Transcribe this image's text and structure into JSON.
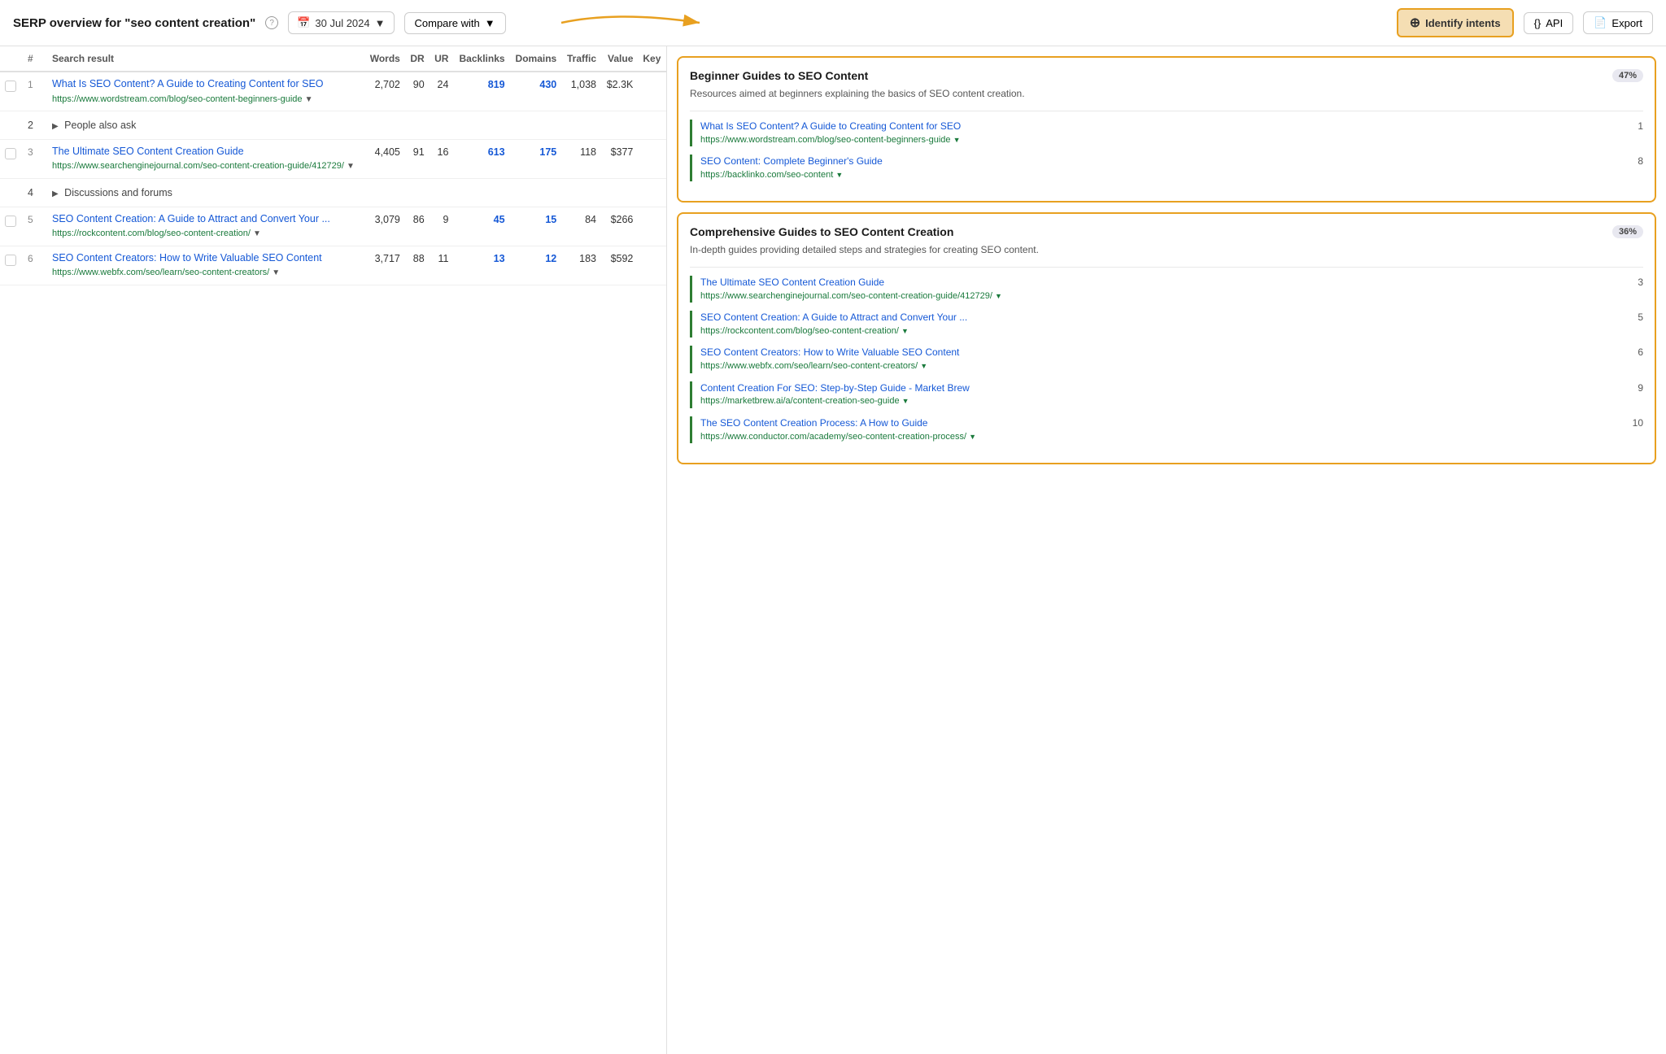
{
  "header": {
    "title": "SERP overview for \"seo content creation\"",
    "help_label": "?",
    "date": "30 Jul 2024",
    "date_icon": "📅",
    "compare_label": "Compare with",
    "compare_arrow": "▼",
    "identify_label": "Identify intents",
    "identify_icon": "⊕",
    "api_label": "API",
    "api_icon": "{}",
    "export_label": "Export",
    "export_icon": "📄"
  },
  "table": {
    "columns": [
      "",
      "#",
      "Search result",
      "Words",
      "DR",
      "UR",
      "Backlinks",
      "Domains",
      "Traffic",
      "Value",
      "Key"
    ],
    "rows": [
      {
        "type": "result",
        "num": 1,
        "title": "What Is SEO Content? A Guide to Creating Content for SEO",
        "url": "https://www.wordstream.com/blog/seo-content-beginners-guide",
        "words": "2,702",
        "dr": "90",
        "ur": "24",
        "backlinks": "819",
        "domains": "430",
        "traffic": "1,038",
        "value": "$2.3K",
        "backlinks_blue": true,
        "domains_blue": true
      },
      {
        "type": "special",
        "num": 2,
        "label": "People also ask"
      },
      {
        "type": "result",
        "num": 3,
        "title": "The Ultimate SEO Content Creation Guide",
        "url": "https://www.searchenginejournal.com/seo-content-creation-guide/412729/",
        "words": "4,405",
        "dr": "91",
        "ur": "16",
        "backlinks": "613",
        "domains": "175",
        "traffic": "118",
        "value": "$377",
        "backlinks_blue": true,
        "domains_blue": true
      },
      {
        "type": "special",
        "num": 4,
        "label": "Discussions and forums"
      },
      {
        "type": "result",
        "num": 5,
        "title": "SEO Content Creation: A Guide to Attract and Convert Your ...",
        "url": "https://rockcontent.com/blog/seo-content-creation/",
        "words": "3,079",
        "dr": "86",
        "ur": "9",
        "backlinks": "45",
        "domains": "15",
        "traffic": "84",
        "value": "$266",
        "backlinks_blue": true,
        "domains_blue": true
      },
      {
        "type": "result",
        "num": 6,
        "title": "SEO Content Creators: How to Write Valuable SEO Content",
        "url": "https://www.webfx.com/seo/learn/seo-content-creators/",
        "words": "3,717",
        "dr": "88",
        "ur": "11",
        "backlinks": "13",
        "domains": "12",
        "traffic": "183",
        "value": "$592",
        "backlinks_blue": true,
        "domains_blue": true
      }
    ]
  },
  "intent_panel": {
    "cards": [
      {
        "id": "beginner",
        "title": "Beginner Guides to SEO Content",
        "percent": "47%",
        "description": "Resources aimed at beginners explaining the basics of SEO content creation.",
        "items": [
          {
            "num": 1,
            "title": "What Is SEO Content? A Guide to Creating Content for SEO",
            "url": "https://www.wordstream.com/blog/seo-content-beginners-guide"
          },
          {
            "num": 8,
            "title": "SEO Content: Complete Beginner's Guide",
            "url": "https://backlinko.com/seo-content"
          }
        ]
      },
      {
        "id": "comprehensive",
        "title": "Comprehensive Guides to SEO Content Creation",
        "percent": "36%",
        "description": "In-depth guides providing detailed steps and strategies for creating SEO content.",
        "items": [
          {
            "num": 3,
            "title": "The Ultimate SEO Content Creation Guide",
            "url": "https://www.searchenginejournal.com/seo-content-creation-guide/412729/"
          },
          {
            "num": 5,
            "title": "SEO Content Creation: A Guide to Attract and Convert Your ...",
            "url": "https://rockcontent.com/blog/seo-content-creation/"
          },
          {
            "num": 6,
            "title": "SEO Content Creators: How to Write Valuable SEO Content",
            "url": "https://www.webfx.com/seo/learn/seo-content-creators/"
          },
          {
            "num": 9,
            "title": "Content Creation For SEO: Step-by-Step Guide - Market Brew",
            "url": "https://marketbrew.ai/a/content-creation-seo-guide"
          },
          {
            "num": 10,
            "title": "The SEO Content Creation Process: A How to Guide",
            "url": "https://www.conductor.com/academy/seo-content-creation-process/"
          }
        ]
      }
    ]
  }
}
